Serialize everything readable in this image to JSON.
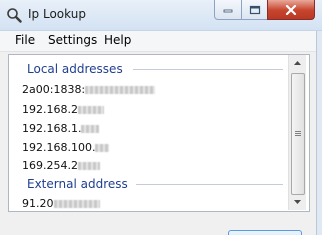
{
  "window": {
    "title": "Ip Lookup"
  },
  "menu": [
    "File",
    "Settings",
    "Help"
  ],
  "sections": {
    "local": {
      "header": "Local addresses",
      "addresses": [
        {
          "prefix": "2a00:1838:"
        },
        {
          "prefix": "192.168.2"
        },
        {
          "prefix": "192.168.1."
        },
        {
          "prefix": "192.168.100."
        },
        {
          "prefix": "169.254.2"
        }
      ]
    },
    "external": {
      "header": "External address",
      "addresses": [
        {
          "prefix": "91.20"
        }
      ]
    }
  },
  "icons": {
    "app": "magnifier-icon",
    "minimize": "minimize-icon",
    "maximize": "maximize-icon",
    "close": "close-icon"
  },
  "colors": {
    "section_header": "#1f3f8f",
    "close_button": "#c7432c"
  }
}
